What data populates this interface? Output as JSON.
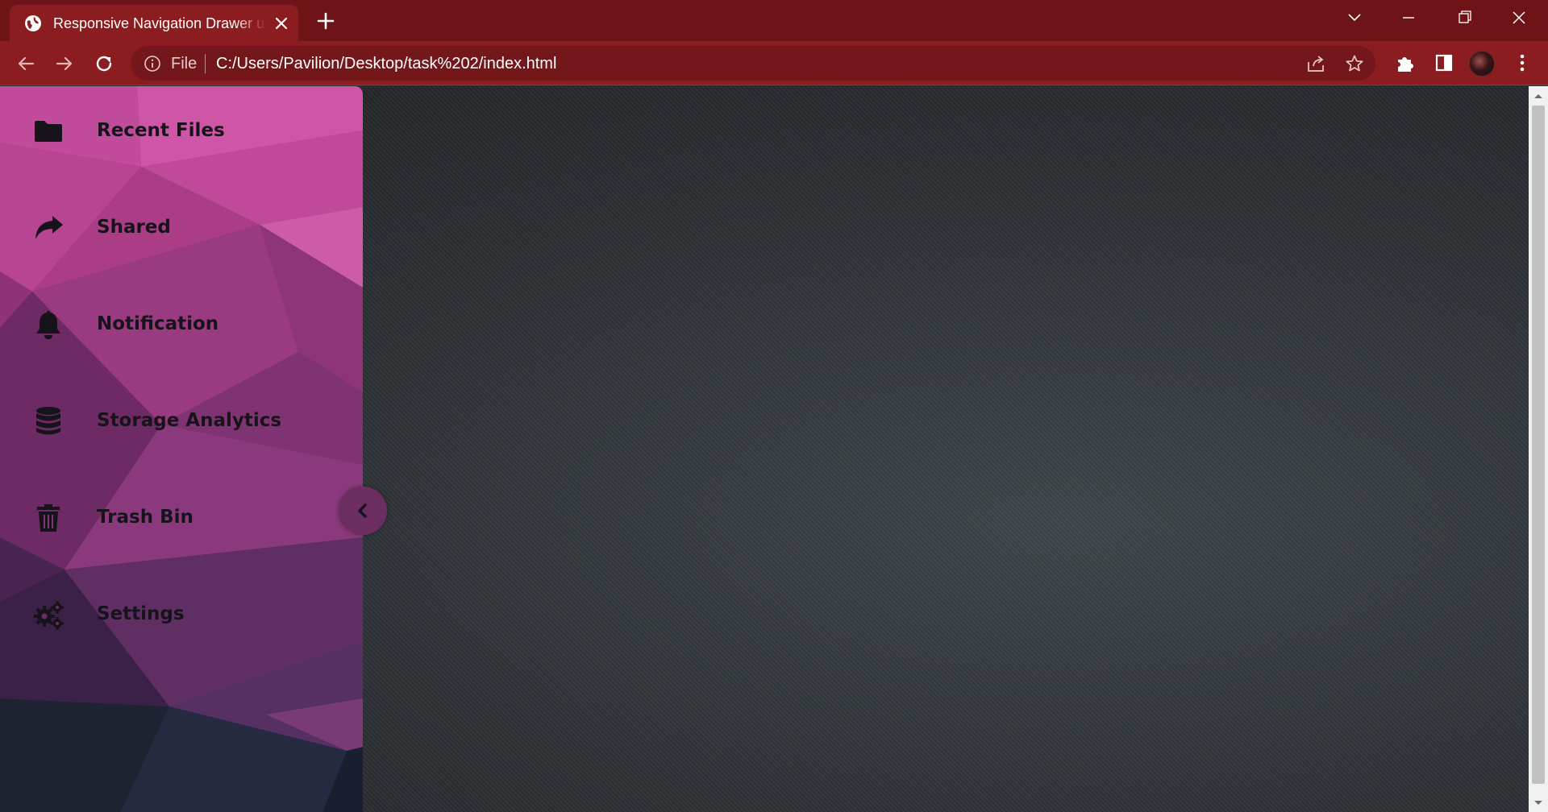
{
  "browser": {
    "tab_title": "Responsive Navigation Drawer using HTML CSS",
    "omnibox_scheme": "File",
    "url": "C:/Users/Pavilion/Desktop/task%202/index.html",
    "theme_colors": {
      "tabbar": "#6e1316",
      "toolbar": "#8b1c20"
    }
  },
  "drawer": {
    "items": [
      {
        "label": "Recent Files",
        "icon": "folder-icon"
      },
      {
        "label": "Shared",
        "icon": "share-arrow-icon"
      },
      {
        "label": "Notification",
        "icon": "bell-icon"
      },
      {
        "label": "Storage Analytics",
        "icon": "database-icon"
      },
      {
        "label": "Trash Bin",
        "icon": "trash-icon"
      },
      {
        "label": "Settings",
        "icon": "gears-icon"
      }
    ],
    "toggle_icon": "chevron-left-icon",
    "colors": {
      "pink": "#c64c9e",
      "purple": "#5a2a5c",
      "dark": "#1d2030"
    }
  }
}
